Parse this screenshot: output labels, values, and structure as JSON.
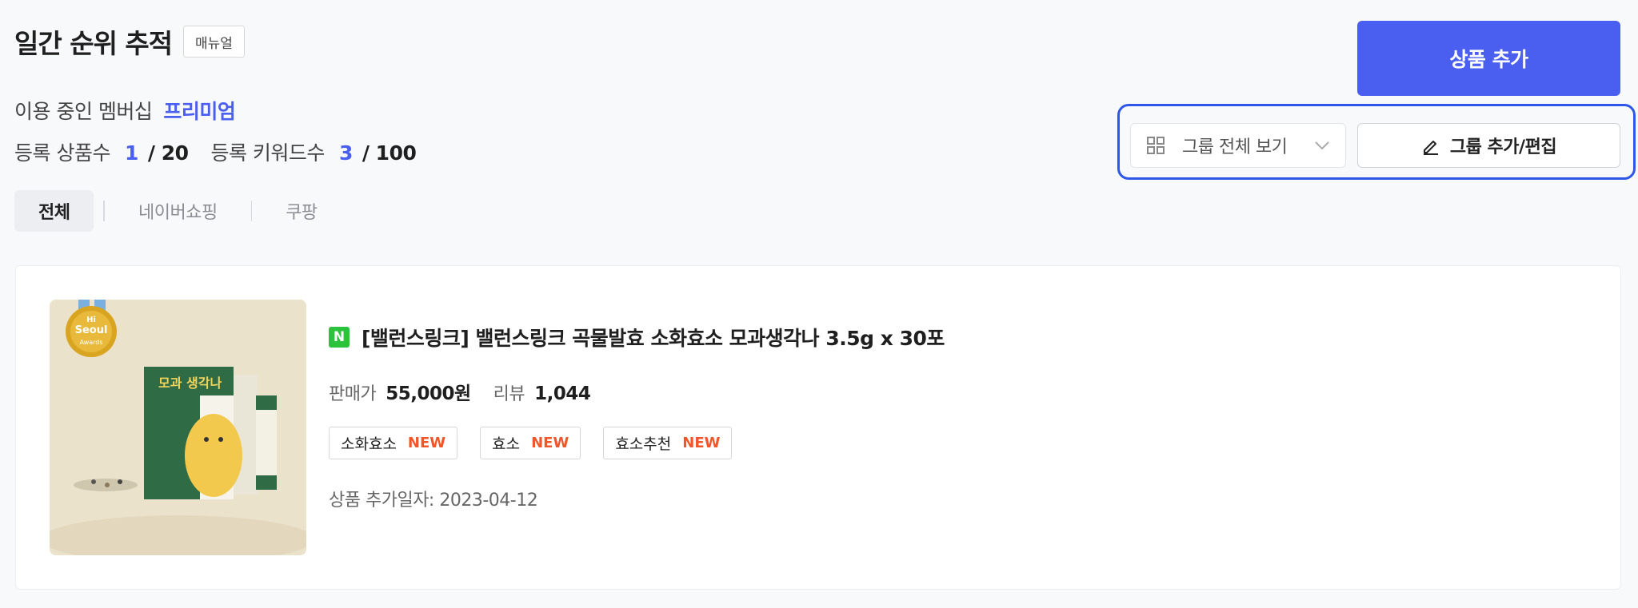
{
  "header": {
    "title": "일간 순위 추적",
    "manual_label": "매뉴얼",
    "membership_label": "이용 중인 멤버십",
    "membership_tier": "프리미엄",
    "product_count_label": "등록 상품수",
    "product_count": "1",
    "product_max": "/ 20",
    "keyword_count_label": "등록 키워드수",
    "keyword_count": "3",
    "keyword_max": "/ 100"
  },
  "tabs": [
    {
      "label": "전체",
      "active": true
    },
    {
      "label": "네이버쇼핑",
      "active": false
    },
    {
      "label": "쿠팡",
      "active": false
    }
  ],
  "actions": {
    "add_product_label": "상품 추가",
    "group_select_value": "그룹 전체 보기",
    "group_edit_label": "그룹 추가/편집"
  },
  "product": {
    "store_badge": "N",
    "title": "[밸런스링크] 밸런스링크 곡물발효 소화효소 모과생각나 3.5g x 30포",
    "price_label": "판매가",
    "price": "55,000원",
    "review_label": "리뷰",
    "review_count": "1,044",
    "keywords": [
      {
        "text": "소화효소",
        "badge": "NEW"
      },
      {
        "text": "효소",
        "badge": "NEW"
      },
      {
        "text": "효소추천",
        "badge": "NEW"
      }
    ],
    "added_date": "상품 추가일자: 2023-04-12",
    "image": {
      "badge_line1": "Hi",
      "badge_line2": "Seoul",
      "badge_line3": "Awards",
      "box_text": "모과 생각나"
    }
  },
  "colors": {
    "accent": "#4a5ff0",
    "highlight": "#2e57e8",
    "new_badge": "#f0562a",
    "naver_green": "#2bc23c"
  }
}
